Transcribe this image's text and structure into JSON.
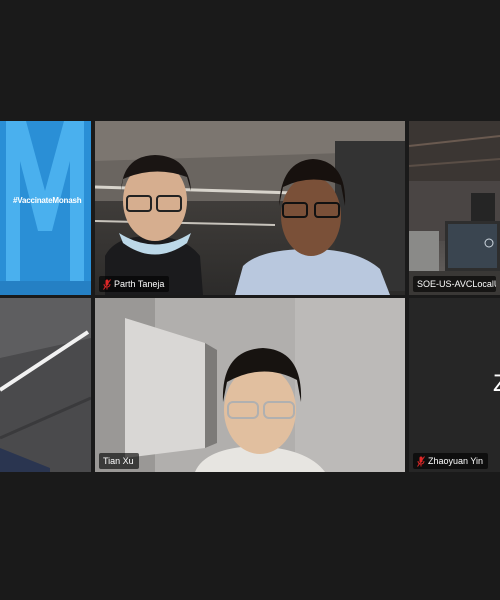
{
  "meeting": {
    "participants": [
      {
        "id": "t1",
        "name": "",
        "banner_text": "#VaccinateMonash",
        "muted": false,
        "speaking": false
      },
      {
        "id": "t2",
        "name": "Parth Taneja",
        "muted": true,
        "speaking": false
      },
      {
        "id": "t3",
        "name": "SOE-US-AVCLocalUser",
        "muted": false,
        "speaking": true
      },
      {
        "id": "t4",
        "name": "",
        "muted": false,
        "speaking": false
      },
      {
        "id": "t5",
        "name": "Tian Xu",
        "muted": false,
        "speaking": false
      },
      {
        "id": "t6",
        "name": "Zhaoyuan Yin",
        "initial": "Z",
        "muted": true,
        "speaking": false
      }
    ]
  },
  "colors": {
    "active_speaker_border": "#2dc24a",
    "muted_icon": "#e02828",
    "banner_blue": "#2a8fd6",
    "background": "#1a1a1a"
  },
  "icons": {
    "muted": "mic-off-icon"
  }
}
